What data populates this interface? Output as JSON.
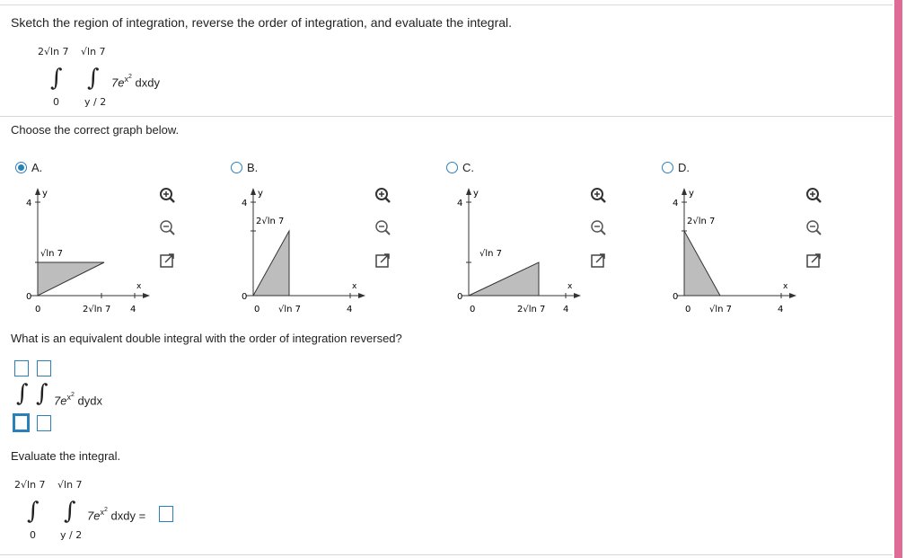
{
  "problem": {
    "instruction": "Sketch the region of integration, reverse the order of integration, and evaluate the integral.",
    "upper_outer": "2√ln 7",
    "upper_inner": "√ln 7",
    "lower_outer": "0",
    "lower_inner": "y / 2",
    "integrand_coef": "7e",
    "integrand_exp": "x",
    "integrand_exp2": "2",
    "differentials": "dxdy"
  },
  "graph_question": "Choose the correct graph below.",
  "options": [
    {
      "letter": "A.",
      "selected": true
    },
    {
      "letter": "B.",
      "selected": false
    },
    {
      "letter": "C.",
      "selected": false
    },
    {
      "letter": "D.",
      "selected": false
    }
  ],
  "graph_labels": {
    "y": "y",
    "x": "x",
    "four": "4",
    "zero": "0",
    "sqrt_ln7": "√ln 7",
    "two_sqrt_ln7": "2√ln 7"
  },
  "reverse_question": "What is an equivalent double integral with the order of integration reversed?",
  "reversed": {
    "integrand_coef": "7e",
    "integrand_exp": "x",
    "integrand_exp2": "2",
    "differentials": "dydx"
  },
  "evaluate_label": "Evaluate the integral.",
  "evaluate": {
    "equals": "="
  },
  "colors": {
    "accent": "#2a80b9",
    "sidebar": "#e06b95"
  }
}
